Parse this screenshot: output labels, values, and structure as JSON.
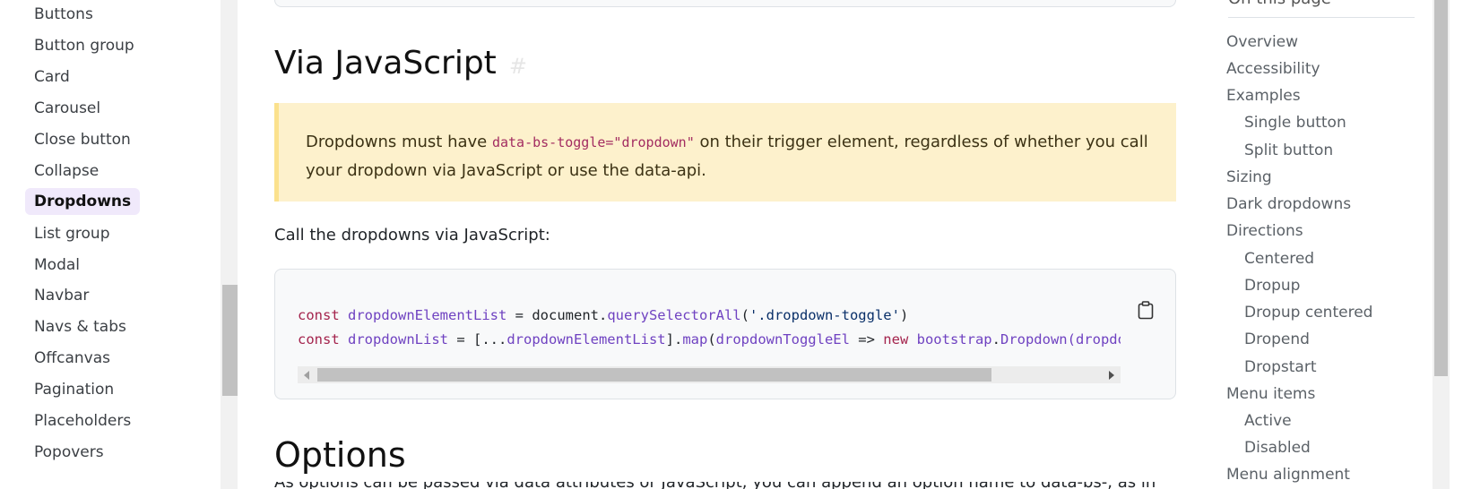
{
  "sidebar": {
    "items": [
      {
        "label": "Buttons"
      },
      {
        "label": "Button group"
      },
      {
        "label": "Card"
      },
      {
        "label": "Carousel"
      },
      {
        "label": "Close button"
      },
      {
        "label": "Collapse"
      },
      {
        "label": "Dropdowns",
        "active": true
      },
      {
        "label": "List group"
      },
      {
        "label": "Modal"
      },
      {
        "label": "Navbar"
      },
      {
        "label": "Navs & tabs"
      },
      {
        "label": "Offcanvas"
      },
      {
        "label": "Pagination"
      },
      {
        "label": "Placeholders"
      },
      {
        "label": "Popovers"
      }
    ]
  },
  "main": {
    "heading_js": "Via JavaScript",
    "heading_anchor": "#",
    "callout": {
      "text_before": "Dropdowns must have ",
      "code": "data-bs-toggle=\"dropdown\"",
      "text_after": " on their trigger element, regardless of whether you call your dropdown via JavaScript or use the data-api."
    },
    "intro": "Call the dropdowns via JavaScript:",
    "code": {
      "line1": {
        "kw": "const",
        "var": "dropdownElementList",
        "eq": " = document.",
        "fn": "querySelectorAll",
        "open": "(",
        "str": "'.dropdown-toggle'",
        "close": ")"
      },
      "line2": {
        "kw": "const",
        "var": "dropdownList",
        "eq": " = [...",
        "var2": "dropdownElementList",
        "mid": "].",
        "fn": "map",
        "open": "(",
        "param": "dropdownToggleEl",
        "arrow": " => ",
        "kw2": "new",
        "sp": " ",
        "obj": "bootstrap",
        "dot": ".",
        "cls": "Dropdown",
        "rest": "(dropdownToggleEl))"
      }
    },
    "heading_options": "Options",
    "cut_paragraph": "As options can be passed via data attributes or JavaScript, you can append an option name to data-bs-, as in"
  },
  "toc": {
    "title": "On this page",
    "items": [
      {
        "label": "Overview",
        "level": 1
      },
      {
        "label": "Accessibility",
        "level": 1
      },
      {
        "label": "Examples",
        "level": 1
      },
      {
        "label": "Single button",
        "level": 2
      },
      {
        "label": "Split button",
        "level": 2
      },
      {
        "label": "Sizing",
        "level": 1
      },
      {
        "label": "Dark dropdowns",
        "level": 1
      },
      {
        "label": "Directions",
        "level": 1
      },
      {
        "label": "Centered",
        "level": 2
      },
      {
        "label": "Dropup",
        "level": 2
      },
      {
        "label": "Dropup centered",
        "level": 2
      },
      {
        "label": "Dropend",
        "level": 2
      },
      {
        "label": "Dropstart",
        "level": 2
      },
      {
        "label": "Menu items",
        "level": 1
      },
      {
        "label": "Active",
        "level": 2
      },
      {
        "label": "Disabled",
        "level": 2
      },
      {
        "label": "Menu alignment",
        "level": 1
      }
    ]
  },
  "colors": {
    "active_bg": "#f0e9fb",
    "callout_bg": "#fdf1cc",
    "callout_border": "#fbe18d",
    "code_keyword": "#a4244d",
    "code_name": "#6f42c1",
    "code_string": "#0a3069"
  },
  "icons": {
    "copy": "clipboard-icon"
  }
}
